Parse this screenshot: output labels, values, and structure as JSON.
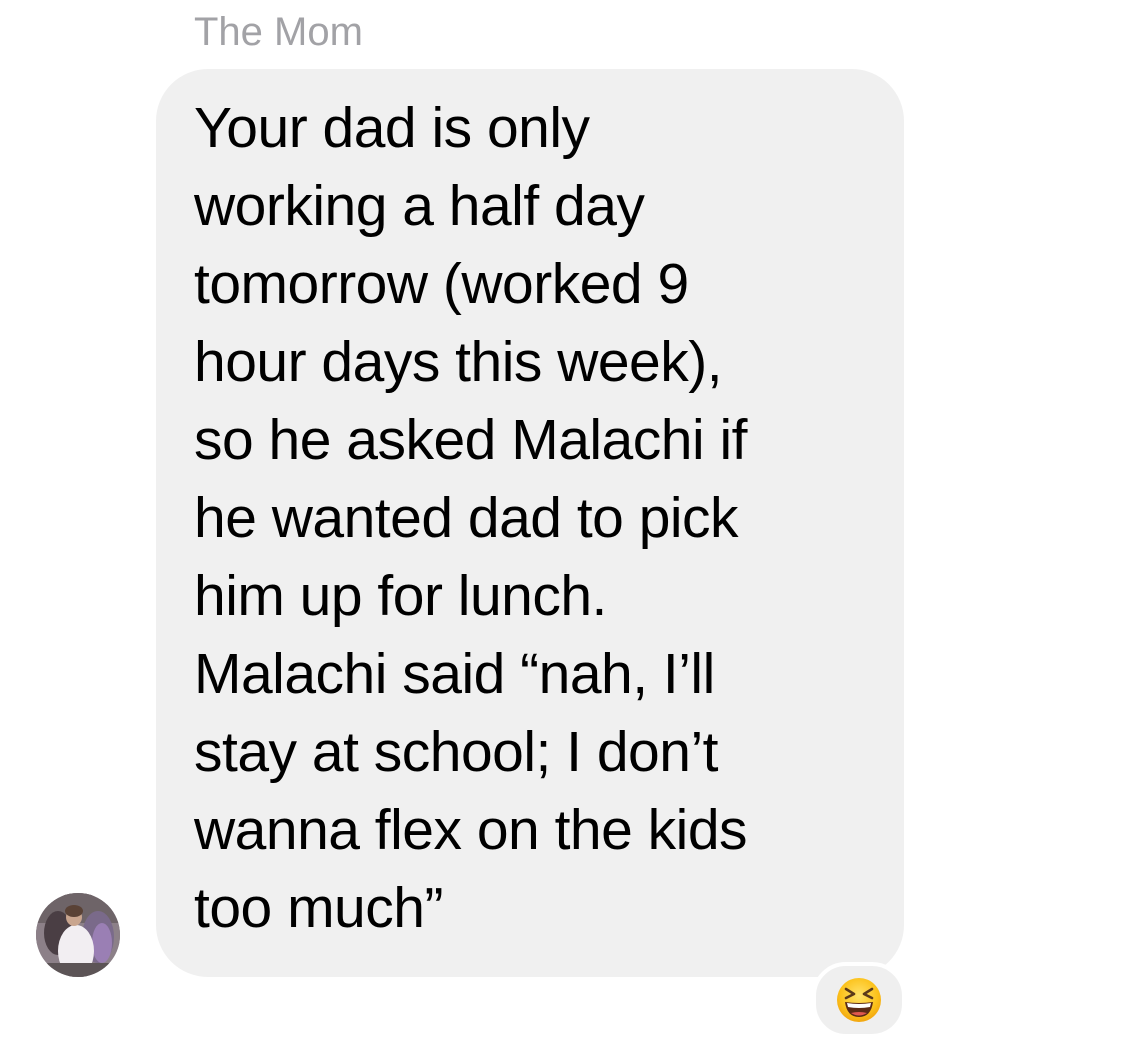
{
  "conversation": {
    "sender_name": "The Mom",
    "message": {
      "lines": [
        "Your dad is only",
        "working a half day",
        "tomorrow (worked 9",
        "hour days this week),",
        "so he asked Malachi if",
        "he wanted dad to pick",
        "him up for lunch.",
        "Malachi said “nah, I’ll",
        "stay at school; I don’t",
        "wanna flex on the kids",
        "too much”"
      ]
    },
    "reaction": {
      "icon": "grinning-squinting-face-icon"
    },
    "avatar": {
      "icon": "profile-photo"
    }
  },
  "colors": {
    "bubble": "#f0f0f0",
    "sender_name": "#a2a2a6",
    "text": "#000000",
    "background": "#ffffff"
  }
}
